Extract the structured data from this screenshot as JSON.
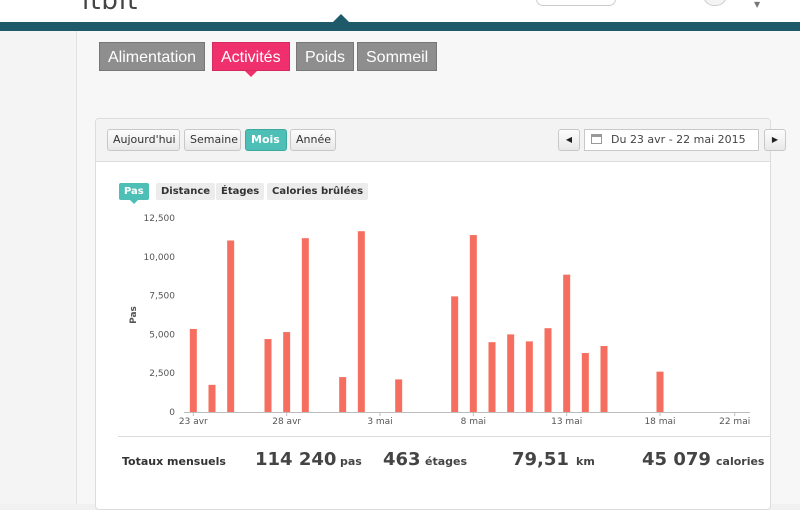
{
  "header": {
    "logo_fragment": "itbit",
    "dropdown_glyph": "▼"
  },
  "category_tabs": [
    "Alimentation",
    "Activités",
    "Poids",
    "Sommeil"
  ],
  "category_active": "Activités",
  "period_tabs": [
    "Aujourd'hui",
    "Semaine",
    "Mois",
    "Année"
  ],
  "period_active": "Mois",
  "date_range": "Du 23 avr - 22 mai 2015",
  "nav": {
    "prev_icon": "◀",
    "next_icon": "▶"
  },
  "metric_tabs": [
    "Pas",
    "Distance",
    "Étages",
    "Calories brûlées"
  ],
  "metric_active": "Pas",
  "accent_color": "#4dbfb6",
  "tab_active_color": "#f0306d",
  "bar_color": "#f66e5f",
  "chart_data": {
    "type": "bar",
    "ylabel": "Pas",
    "ylim": [
      0,
      12500
    ],
    "yticks": [
      "0",
      "2,500",
      "5,000",
      "7,500",
      "10,000",
      "12,500"
    ],
    "grid": false,
    "x_tick_labels": [
      "23 avr",
      "28 avr",
      "3 mai",
      "8 mai",
      "13 mai",
      "18 mai",
      "22 mai"
    ],
    "x": [
      "23 avr",
      "24 avr",
      "25 avr",
      "26 avr",
      "27 avr",
      "28 avr",
      "29 avr",
      "30 avr",
      "1 mai",
      "2 mai",
      "3 mai",
      "4 mai",
      "5 mai",
      "6 mai",
      "7 mai",
      "8 mai",
      "9 mai",
      "10 mai",
      "11 mai",
      "12 mai",
      "13 mai",
      "14 mai",
      "15 mai",
      "16 mai",
      "17 mai",
      "18 mai",
      "19 mai",
      "20 mai",
      "21 mai",
      "22 mai"
    ],
    "values": [
      5350,
      1750,
      11050,
      0,
      4700,
      5150,
      11200,
      0,
      2250,
      11650,
      0,
      2100,
      0,
      0,
      7450,
      11400,
      4500,
      5000,
      4550,
      5400,
      8850,
      3800,
      4250,
      0,
      0,
      2600,
      0,
      0,
      0,
      0
    ]
  },
  "totals": {
    "label": "Totaux mensuels",
    "steps": "114 240",
    "steps_unit": "pas",
    "floors": "463",
    "floors_unit": "étages",
    "distance": "79,51",
    "distance_unit": "km",
    "calories": "45 079",
    "calories_unit": "calories"
  }
}
